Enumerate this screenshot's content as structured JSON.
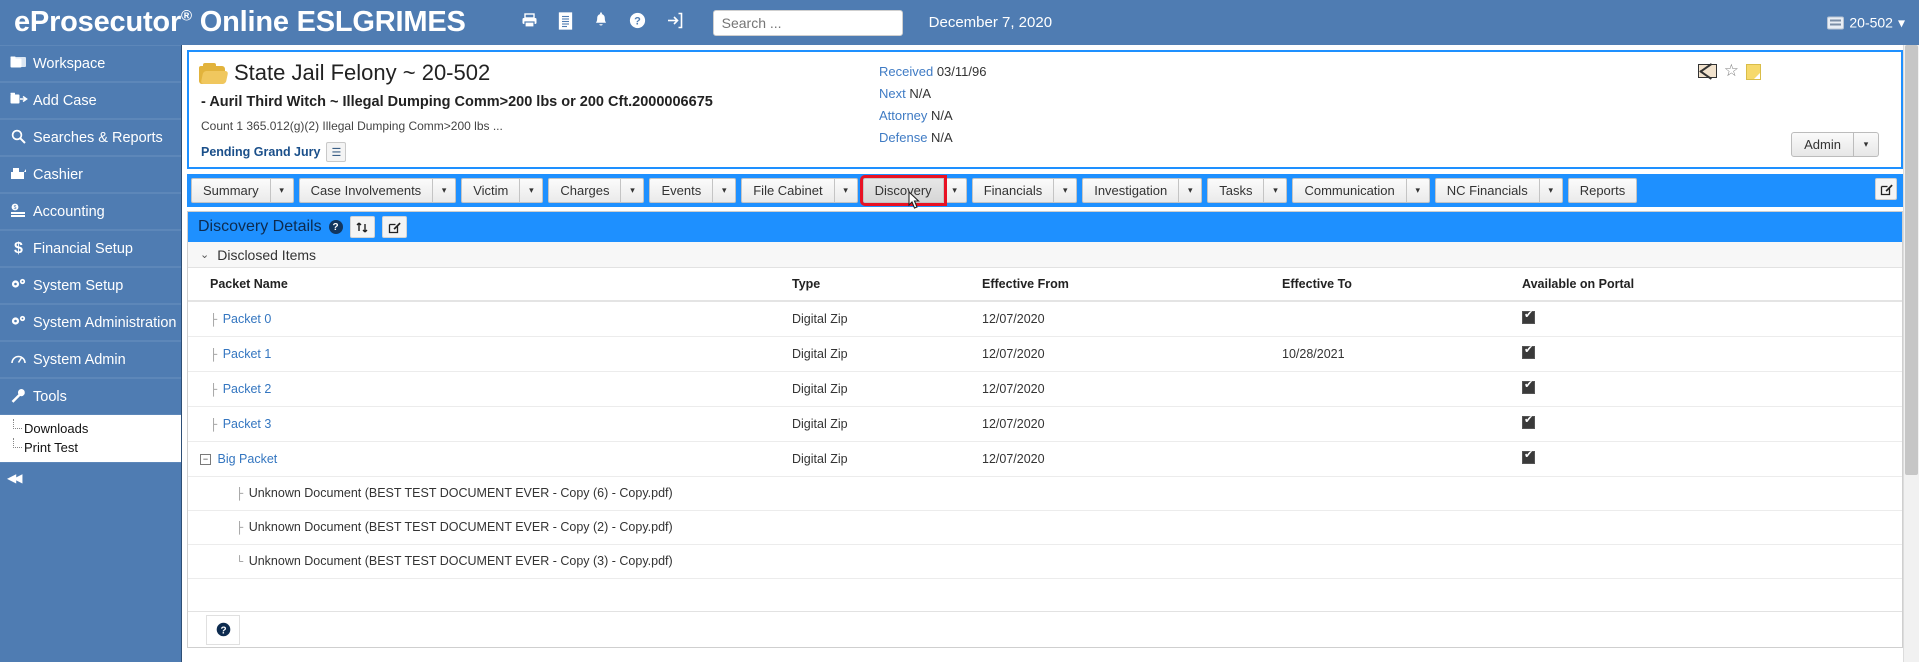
{
  "topbar": {
    "brand_prefix": "eProsecutor",
    "brand_reg": "®",
    "brand_suffix": " Online ESLGRIMES",
    "icons": [
      "print-icon",
      "document-icon",
      "bell-icon",
      "help-icon",
      "logout-icon"
    ],
    "search_placeholder": "Search ...",
    "search_value": "",
    "date": "December 7, 2020",
    "case_ref": "20-502",
    "case_ref_caret": "▾",
    "accent": "#4f7cb2"
  },
  "sidebar": {
    "items": [
      {
        "label": "Workspace",
        "icon": "folders-icon",
        "glyph": "🗂"
      },
      {
        "label": "Add Case",
        "icon": "add-case-icon",
        "glyph": "🗅"
      },
      {
        "label": "Searches & Reports",
        "icon": "search-icon",
        "glyph": "🔍"
      },
      {
        "label": "Cashier",
        "icon": "cash-register-icon",
        "glyph": "🖩"
      },
      {
        "label": "Accounting",
        "icon": "accounting-icon",
        "glyph": "🖩"
      },
      {
        "label": "Financial Setup",
        "icon": "dollar-icon",
        "glyph": "$"
      },
      {
        "label": "System Setup",
        "icon": "gears-icon",
        "glyph": "⚙"
      },
      {
        "label": "System Administration",
        "icon": "gears-icon",
        "glyph": "⚙"
      },
      {
        "label": "System Admin",
        "icon": "gauge-icon",
        "glyph": "◔"
      },
      {
        "label": "Tools",
        "icon": "wrench-icon",
        "glyph": "🔧"
      }
    ],
    "sub_items": [
      {
        "label": "Downloads"
      },
      {
        "label": "Print Test"
      }
    ],
    "collapse_glyph": "◀◀"
  },
  "case_header": {
    "title": "State Jail Felony ~ 20-502",
    "subtitle": "- Auril Third Witch ~ Illegal Dumping Comm>200 lbs or 200 Cft.2000006675",
    "count_line": "Count 1 365.012(g)(2) Illegal Dumping Comm>200 lbs ...",
    "status": "Pending Grand Jury",
    "note_glyph": "☰",
    "meta": [
      {
        "label": "Received",
        "value": "03/11/96"
      },
      {
        "label": "Next",
        "value": "N/A"
      },
      {
        "label": "Attorney",
        "value": "N/A"
      },
      {
        "label": "Defense",
        "value": "N/A"
      }
    ],
    "flag_icons": [
      "envelope-icon",
      "star-icon",
      "sticky-note-icon"
    ],
    "star_glyph": "☆",
    "admin_label": "Admin",
    "admin_caret": "▾",
    "border_color": "#1e90ff"
  },
  "tabs": {
    "caret": "▾",
    "items": [
      {
        "label": "Summary",
        "has_arrow": true,
        "active": false
      },
      {
        "label": "Case Involvements",
        "has_arrow": true,
        "active": false
      },
      {
        "label": "Victim",
        "has_arrow": true,
        "active": false
      },
      {
        "label": "Charges",
        "has_arrow": true,
        "active": false
      },
      {
        "label": "Events",
        "has_arrow": true,
        "active": false
      },
      {
        "label": "File Cabinet",
        "has_arrow": true,
        "active": false
      },
      {
        "label": "Discovery",
        "has_arrow": true,
        "active": true
      },
      {
        "label": "Financials",
        "has_arrow": true,
        "active": false
      },
      {
        "label": "Investigation",
        "has_arrow": true,
        "active": false
      },
      {
        "label": "Tasks",
        "has_arrow": true,
        "active": false
      },
      {
        "label": "Communication",
        "has_arrow": true,
        "active": false
      },
      {
        "label": "NC Financials",
        "has_arrow": true,
        "active": false
      },
      {
        "label": "Reports",
        "has_arrow": false,
        "active": false
      }
    ],
    "edit_corner_glyph": "🖉",
    "highlight_color": "#e81123",
    "strip_color": "#1e90ff"
  },
  "panel": {
    "title": "Discovery Details",
    "help_glyph": "?",
    "refresh_glyph": "⇅",
    "edit_glyph": "🖉",
    "section_label": "Disclosed Items",
    "section_chevron": "⌄",
    "columns": [
      "Packet Name",
      "Type",
      "Effective From",
      "Effective To",
      "Available on Portal"
    ],
    "rows": [
      {
        "name": "Packet 0",
        "type": "Digital Zip",
        "from": "12/07/2020",
        "to": "",
        "portal": true,
        "child": false,
        "expandable": false,
        "link": true
      },
      {
        "name": "Packet 1",
        "type": "Digital Zip",
        "from": "12/07/2020",
        "to": "10/28/2021",
        "portal": true,
        "child": false,
        "expandable": false,
        "link": true
      },
      {
        "name": "Packet 2",
        "type": "Digital Zip",
        "from": "12/07/2020",
        "to": "",
        "portal": true,
        "child": false,
        "expandable": false,
        "link": true
      },
      {
        "name": "Packet 3",
        "type": "Digital Zip",
        "from": "12/07/2020",
        "to": "",
        "portal": true,
        "child": false,
        "expandable": false,
        "link": true
      },
      {
        "name": "Big Packet",
        "type": "Digital Zip",
        "from": "12/07/2020",
        "to": "",
        "portal": true,
        "child": false,
        "expandable": true,
        "expander_glyph": "−",
        "link": true
      },
      {
        "name": "Unknown Document (BEST TEST DOCUMENT EVER - Copy (6) - Copy.pdf)",
        "type": "",
        "from": "",
        "to": "",
        "portal": false,
        "child": true,
        "expandable": false,
        "link": false
      },
      {
        "name": "Unknown Document (BEST TEST DOCUMENT EVER - Copy (2) - Copy.pdf)",
        "type": "",
        "from": "",
        "to": "",
        "portal": false,
        "child": true,
        "expandable": false,
        "link": false
      },
      {
        "name": "Unknown Document (BEST TEST DOCUMENT EVER - Copy (3) - Copy.pdf)",
        "type": "",
        "from": "",
        "to": "",
        "portal": false,
        "child": true,
        "expandable": false,
        "link": false
      }
    ],
    "footer_help_glyph": "?"
  }
}
